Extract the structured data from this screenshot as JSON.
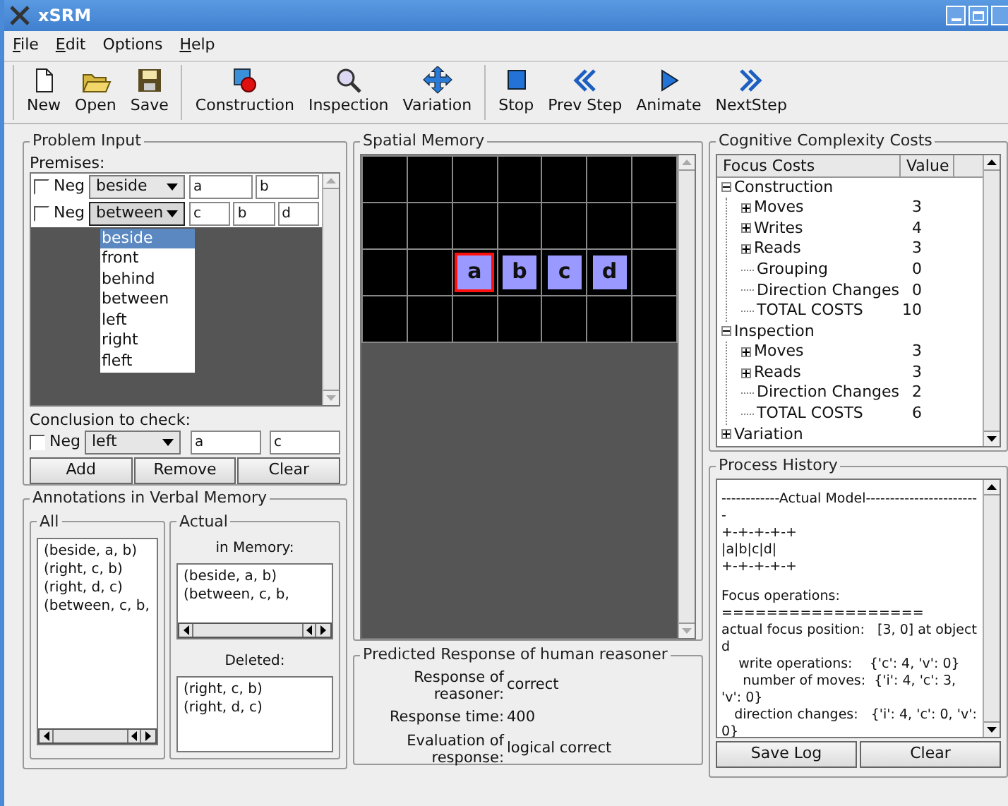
{
  "window": {
    "title": "xSRM"
  },
  "menu": [
    {
      "label": "File",
      "mnemonic": true
    },
    {
      "label": "Edit",
      "mnemonic": true
    },
    {
      "label": "Options",
      "mnemonic": false
    },
    {
      "label": "Help",
      "mnemonic": true
    }
  ],
  "toolbar": [
    [
      {
        "label": "New",
        "kind": "new"
      },
      {
        "label": "Open",
        "kind": "open"
      },
      {
        "label": "Save",
        "kind": "save"
      }
    ],
    [
      {
        "label": "Construction",
        "kind": "construction"
      },
      {
        "label": "Inspection",
        "kind": "inspection"
      },
      {
        "label": "Variation",
        "kind": "variation"
      }
    ],
    [
      {
        "label": "Stop",
        "kind": "stop"
      },
      {
        "label": "Prev Step",
        "kind": "prev"
      },
      {
        "label": "Animate",
        "kind": "animate"
      },
      {
        "label": "NextStep",
        "kind": "next"
      }
    ]
  ],
  "problem_input": {
    "title": "Problem Input",
    "premises_label": "Premises:",
    "premises": [
      {
        "neg_label": "Neg",
        "checked": false,
        "relation": "beside",
        "args": [
          "a",
          "b"
        ],
        "expanded": false
      },
      {
        "neg_label": "Neg",
        "checked": false,
        "relation": "between",
        "args": [
          "c",
          "b",
          "d"
        ],
        "expanded": true
      }
    ],
    "dropdown_options": [
      {
        "label": "beside",
        "selected": true
      },
      {
        "label": "front",
        "selected": false
      },
      {
        "label": "behind",
        "selected": false
      },
      {
        "label": "between",
        "selected": false
      },
      {
        "label": "left",
        "selected": false
      },
      {
        "label": "right",
        "selected": false
      },
      {
        "label": "fleft",
        "selected": false
      }
    ],
    "conclusion_label": "Conclusion to check:",
    "conclusion": {
      "neg_label": "Neg",
      "checked": false,
      "relation": "left",
      "args": [
        "a",
        "c"
      ]
    },
    "buttons": [
      "Add",
      "Remove",
      "Clear"
    ]
  },
  "annotations": {
    "title": "Annotations in Verbal Memory",
    "all": {
      "title": "All",
      "items": [
        "(beside, a, b)",
        "(right, c, b)",
        "(right, d, c)",
        "(between, c, b,"
      ]
    },
    "actual": {
      "title": "Actual",
      "memory_label": "in Memory:",
      "memory_items": [
        "(beside, a, b)",
        "(between, c, b,"
      ],
      "deleted_label": "Deleted:",
      "deleted_items": [
        "(right, c, b)",
        "(right, d, c)"
      ]
    }
  },
  "spatial_memory": {
    "title": "Spatial Memory",
    "rows": [
      [
        null,
        null,
        null,
        null,
        null,
        null,
        null
      ],
      [
        null,
        null,
        null,
        null,
        null,
        null,
        null
      ],
      [
        null,
        null,
        {
          "label": "a",
          "focused": true
        },
        {
          "label": "b",
          "focused": false
        },
        {
          "label": "c",
          "focused": false
        },
        {
          "label": "d",
          "focused": false
        },
        null
      ],
      [
        null,
        null,
        null,
        null,
        null,
        null,
        null
      ]
    ]
  },
  "predicted_response": {
    "title": "Predicted Response of human reasoner",
    "fields": [
      {
        "label": "Response of reasoner:",
        "value": "correct"
      },
      {
        "label": "Response time:",
        "value": "400"
      },
      {
        "label": "Evaluation of response:",
        "value": "logical correct"
      }
    ]
  },
  "costs": {
    "title": "Cognitive Complexity Costs",
    "columns": [
      "Focus Costs",
      "Value"
    ],
    "tree": [
      {
        "label": "Construction",
        "expanded": true,
        "children": [
          {
            "label": "Moves",
            "value": "3",
            "expanded": false
          },
          {
            "label": "Writes",
            "value": "4",
            "expanded": false
          },
          {
            "label": "Reads",
            "value": "3",
            "expanded": false
          },
          {
            "label": "Grouping",
            "value": "0"
          },
          {
            "label": "Direction Changes",
            "value": "0"
          },
          {
            "label": "TOTAL COSTS",
            "value": "10"
          }
        ]
      },
      {
        "label": "Inspection",
        "expanded": true,
        "children": [
          {
            "label": "Moves",
            "value": "3",
            "expanded": false
          },
          {
            "label": "Reads",
            "value": "3",
            "expanded": false
          },
          {
            "label": "Direction Changes",
            "value": "2"
          },
          {
            "label": "TOTAL COSTS",
            "value": "6"
          }
        ]
      },
      {
        "label": "Variation",
        "expanded": false
      }
    ]
  },
  "history": {
    "title": "Process History",
    "paragraphs": [
      [
        "------------Actual Model------------------------",
        "+-+-+-+-+",
        "|a|b|c|d|",
        "+-+-+-+-+"
      ],
      [
        "Focus operations:",
        "==================",
        "actual focus position:   [3, 0] at object d",
        "    write operations:    {'c': 4, 'v': 0}",
        "     number of moves:  {'i': 4, 'c': 3, 'v': 0}",
        "   direction changes:   {'i': 4, 'c': 0, 'v': 0}"
      ]
    ],
    "buttons": [
      "Save Log",
      "Clear"
    ]
  }
}
